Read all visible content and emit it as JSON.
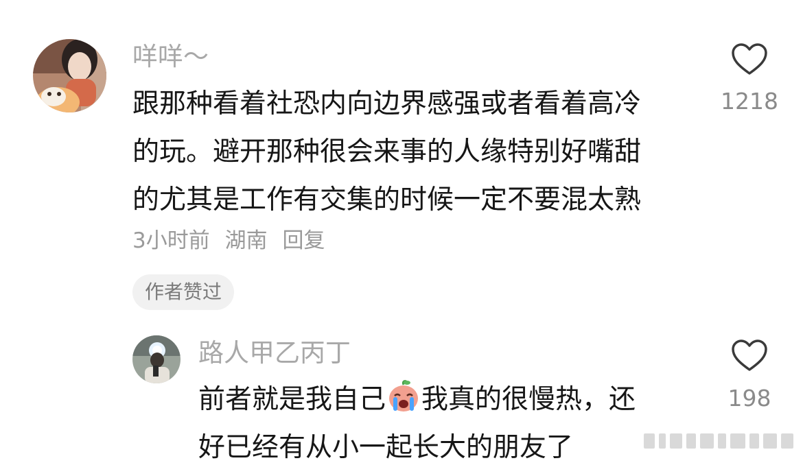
{
  "comments": [
    {
      "username": "咩咩～",
      "lines": [
        "跟那种看着社恐内向边界感强或者看着高冷",
        "的玩。避开那种很会来事的人缘特别好嘴甜",
        "的尤其是工作有交集的时候一定不要混太熟"
      ],
      "time": "3小时前",
      "location": "湖南",
      "reply_label": "回复",
      "badge": "作者赞过",
      "like_count": "1218",
      "like_icon": "heart-outline-icon"
    }
  ],
  "replies": [
    {
      "username": "路人甲乙丙丁",
      "line1_before": "前者就是我自己",
      "line1_emoji": "crying-emoji",
      "line1_after": "我真的很慢热，还",
      "line2": "好已经有从小一起长大的朋友了",
      "like_count": "198",
      "like_icon": "heart-outline-icon"
    }
  ]
}
